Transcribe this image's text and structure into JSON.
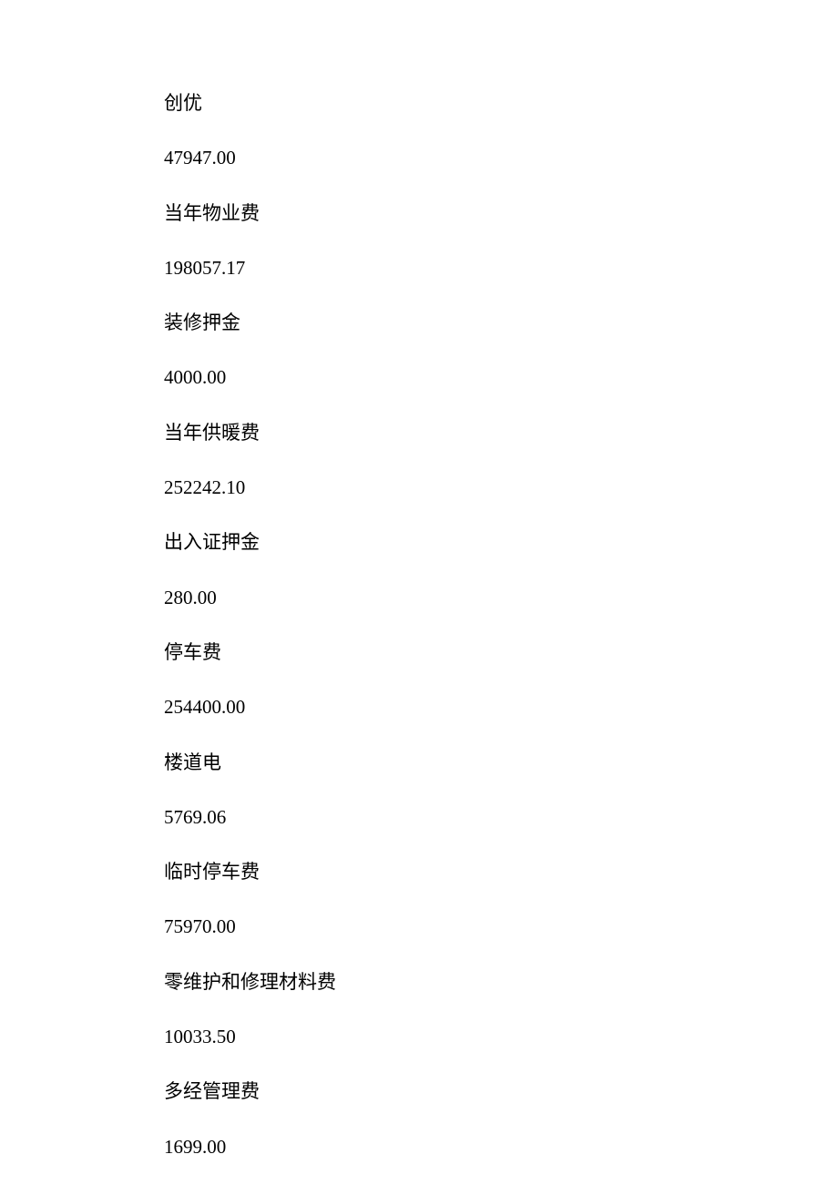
{
  "items": [
    {
      "label": "创优",
      "value": "47947.00"
    },
    {
      "label": "当年物业费",
      "value": "198057.17"
    },
    {
      "label": "装修押金",
      "value": "4000.00"
    },
    {
      "label": "当年供暖费",
      "value": "252242.10"
    },
    {
      "label": "出入证押金",
      "value": "280.00"
    },
    {
      "label": "停车费",
      "value": "254400.00"
    },
    {
      "label": "楼道电",
      "value": "5769.06"
    },
    {
      "label": "临时停车费",
      "value": "75970.00"
    },
    {
      "label": "零维护和修理材料费",
      "value": "10033.50"
    },
    {
      "label": "多经管理费",
      "value": "1699.00"
    }
  ]
}
